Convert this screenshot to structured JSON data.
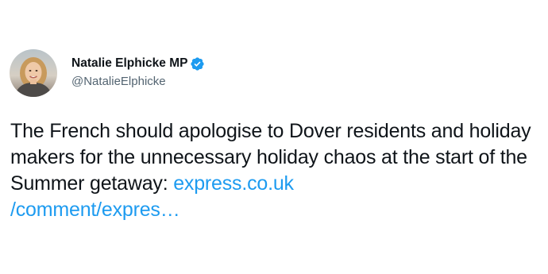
{
  "author": {
    "display_name": "Natalie Elphicke MP",
    "handle": "@NatalieElphicke",
    "verified": true,
    "avatar_icon": "profile-photo"
  },
  "tweet": {
    "text": "The French should apologise to Dover residents and holiday makers for the unnecessary holiday chaos at the start of the Summer getaway:",
    "link_line1": "express.co.uk",
    "link_line2": "/comment/expres…"
  },
  "colors": {
    "text": "#0f1419",
    "secondary_text": "#536471",
    "link": "#1d9bf0",
    "verified_badge": "#1d9bf0"
  }
}
